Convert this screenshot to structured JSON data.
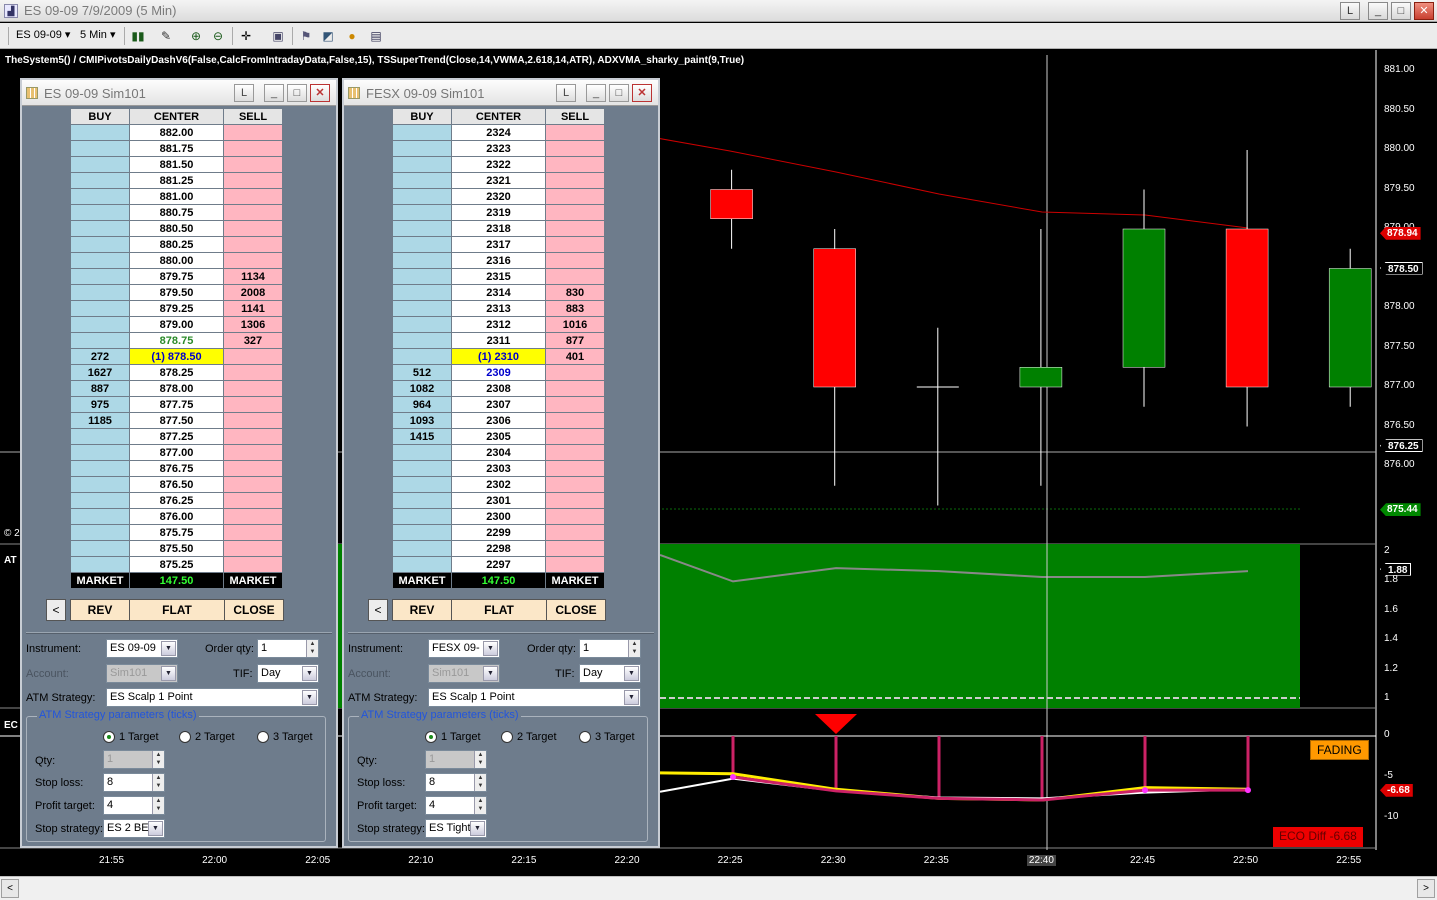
{
  "window": {
    "title": "ES 09-09  7/9/2009 (5 Min)",
    "restore_label": "L",
    "minimize_label": "_",
    "maximize_label": "□",
    "close_label": "✕"
  },
  "toolbar": {
    "instrument": "ES 09-09",
    "interval": "5 Min"
  },
  "chart": {
    "indicator_text": "TheSystem5() / CMIPivotsDailyDashV6(False,CalcFromIntradayData,False,15), TSSuperTrend(Close,14,VWMA,2.618,14,ATR), ADXVMA_sharky_paint(9,True)",
    "left_labels": [
      "© 2",
      "AT",
      "EC"
    ],
    "price_axis": [
      "881.00",
      "880.50",
      "880.00",
      "879.50",
      "879.00",
      "878.50",
      "878.00",
      "877.50",
      "877.00",
      "876.50",
      "876.25",
      "876.00",
      "875.44"
    ],
    "price_tags": [
      {
        "value": "878.94",
        "bg": "#dd0000",
        "fg": "#ffffff"
      },
      {
        "value": "878.50",
        "bg": "#000000",
        "fg": "#ffffff"
      },
      {
        "value": "876.25",
        "bg": "#000000",
        "fg": "#ffffff"
      },
      {
        "value": "875.44",
        "bg": "#008800",
        "fg": "#ffffff"
      }
    ],
    "atr_axis": [
      "2",
      "1.8",
      "1.6",
      "1.4",
      "1.2",
      "1"
    ],
    "atr_tag": "1.88",
    "eco_axis": [
      "0",
      "-5",
      "-10"
    ],
    "eco_tag": "-6.68",
    "fading_label": "FADING",
    "eco_diff_label": "ECO Diff -6.68",
    "time_axis": [
      "21:55",
      "22:00",
      "22:05",
      "22:10",
      "22:15",
      "22:20",
      "22:25",
      "22:30",
      "22:35",
      "22:40",
      "22:45",
      "22:50",
      "22:55"
    ],
    "colors": {
      "up": "#008000",
      "down": "#ff0000",
      "atr_bg": "#008000",
      "eco_pink": "#cc2266",
      "eco_yellow": "#ffee00"
    },
    "candles": [
      {
        "time": "22:25",
        "open": 879.5,
        "high": 879.75,
        "low": 878.75,
        "close": 879.13
      },
      {
        "time": "22:30",
        "open": 878.75,
        "high": 879.0,
        "low": 875.75,
        "close": 877.0
      },
      {
        "time": "22:35",
        "open": 877.0,
        "high": 877.75,
        "low": 875.5,
        "close": 877.0
      },
      {
        "time": "22:40",
        "open": 877.0,
        "high": 879.0,
        "low": 875.75,
        "close": 877.25
      },
      {
        "time": "22:45",
        "open": 877.25,
        "high": 879.5,
        "low": 876.75,
        "close": 879.0
      },
      {
        "time": "22:50",
        "open": 879.0,
        "high": 880.0,
        "low": 876.5,
        "close": 877.0
      },
      {
        "time": "22:55",
        "open": 877.0,
        "high": 878.75,
        "low": 876.75,
        "close": 878.5
      }
    ]
  },
  "dom_windows": [
    {
      "title": "ES 09-09 Sim101",
      "headers": {
        "buy": "BUY",
        "center": "CENTER",
        "sell": "SELL"
      },
      "rows": [
        {
          "buy": "",
          "center": "882.00",
          "sell": ""
        },
        {
          "buy": "",
          "center": "881.75",
          "sell": ""
        },
        {
          "buy": "",
          "center": "881.50",
          "sell": ""
        },
        {
          "buy": "",
          "center": "881.25",
          "sell": ""
        },
        {
          "buy": "",
          "center": "881.00",
          "sell": ""
        },
        {
          "buy": "",
          "center": "880.75",
          "sell": ""
        },
        {
          "buy": "",
          "center": "880.50",
          "sell": ""
        },
        {
          "buy": "",
          "center": "880.25",
          "sell": ""
        },
        {
          "buy": "",
          "center": "880.00",
          "sell": ""
        },
        {
          "buy": "",
          "center": "879.75",
          "sell": "1134"
        },
        {
          "buy": "",
          "center": "879.50",
          "sell": "2008"
        },
        {
          "buy": "",
          "center": "879.25",
          "sell": "1141"
        },
        {
          "buy": "",
          "center": "879.00",
          "sell": "1306"
        },
        {
          "buy": "",
          "center": "878.75",
          "sell": "327",
          "style": "last"
        },
        {
          "buy": "272",
          "center": "(1) 878.50",
          "sell": "",
          "style": "cur"
        },
        {
          "buy": "1627",
          "center": "878.25",
          "sell": ""
        },
        {
          "buy": "887",
          "center": "878.00",
          "sell": ""
        },
        {
          "buy": "975",
          "center": "877.75",
          "sell": ""
        },
        {
          "buy": "1185",
          "center": "877.50",
          "sell": ""
        },
        {
          "buy": "",
          "center": "877.25",
          "sell": ""
        },
        {
          "buy": "",
          "center": "877.00",
          "sell": ""
        },
        {
          "buy": "",
          "center": "876.75",
          "sell": ""
        },
        {
          "buy": "",
          "center": "876.50",
          "sell": ""
        },
        {
          "buy": "",
          "center": "876.25",
          "sell": ""
        },
        {
          "buy": "",
          "center": "876.00",
          "sell": ""
        },
        {
          "buy": "",
          "center": "875.75",
          "sell": ""
        },
        {
          "buy": "",
          "center": "875.50",
          "sell": ""
        },
        {
          "buy": "",
          "center": "875.25",
          "sell": ""
        }
      ],
      "market": {
        "left": "MARKET",
        "center": "147.50",
        "right": "MARKET"
      },
      "buttons": {
        "back": "<",
        "rev": "REV",
        "flat": "FLAT",
        "close": "CLOSE"
      },
      "instrument_label": "Instrument:",
      "instrument": "ES 09-09",
      "order_qty_label": "Order qty:",
      "order_qty": "1",
      "account_label": "Account:",
      "account": "Sim101",
      "tif_label": "TIF:",
      "tif": "Day",
      "atm_label": "ATM Strategy:",
      "atm": "ES Scalp 1 Point",
      "params_label": "ATM Strategy parameters (ticks)",
      "targets": [
        "1 Target",
        "2 Target",
        "3 Target"
      ],
      "selected_target": 0,
      "qty_label": "Qty:",
      "qty": "1",
      "stop_loss_label": "Stop loss:",
      "stop_loss": "8",
      "profit_target_label": "Profit target:",
      "profit_target": "4",
      "stop_strategy_label": "Stop strategy:",
      "stop_strategy": "ES 2 BE"
    },
    {
      "title": "FESX 09-09 Sim101",
      "headers": {
        "buy": "BUY",
        "center": "CENTER",
        "sell": "SELL"
      },
      "rows": [
        {
          "buy": "",
          "center": "2324",
          "sell": ""
        },
        {
          "buy": "",
          "center": "2323",
          "sell": ""
        },
        {
          "buy": "",
          "center": "2322",
          "sell": ""
        },
        {
          "buy": "",
          "center": "2321",
          "sell": ""
        },
        {
          "buy": "",
          "center": "2320",
          "sell": ""
        },
        {
          "buy": "",
          "center": "2319",
          "sell": ""
        },
        {
          "buy": "",
          "center": "2318",
          "sell": ""
        },
        {
          "buy": "",
          "center": "2317",
          "sell": ""
        },
        {
          "buy": "",
          "center": "2316",
          "sell": ""
        },
        {
          "buy": "",
          "center": "2315",
          "sell": ""
        },
        {
          "buy": "",
          "center": "2314",
          "sell": "830"
        },
        {
          "buy": "",
          "center": "2313",
          "sell": "883"
        },
        {
          "buy": "",
          "center": "2312",
          "sell": "1016"
        },
        {
          "buy": "",
          "center": "2311",
          "sell": "877"
        },
        {
          "buy": "",
          "center": "(1) 2310",
          "sell": "401",
          "style": "cur"
        },
        {
          "buy": "512",
          "center": "2309",
          "sell": "",
          "style": "bid"
        },
        {
          "buy": "1082",
          "center": "2308",
          "sell": ""
        },
        {
          "buy": "964",
          "center": "2307",
          "sell": ""
        },
        {
          "buy": "1093",
          "center": "2306",
          "sell": ""
        },
        {
          "buy": "1415",
          "center": "2305",
          "sell": ""
        },
        {
          "buy": "",
          "center": "2304",
          "sell": ""
        },
        {
          "buy": "",
          "center": "2303",
          "sell": ""
        },
        {
          "buy": "",
          "center": "2302",
          "sell": ""
        },
        {
          "buy": "",
          "center": "2301",
          "sell": ""
        },
        {
          "buy": "",
          "center": "2300",
          "sell": ""
        },
        {
          "buy": "",
          "center": "2299",
          "sell": ""
        },
        {
          "buy": "",
          "center": "2298",
          "sell": ""
        },
        {
          "buy": "",
          "center": "2297",
          "sell": ""
        }
      ],
      "market": {
        "left": "MARKET",
        "center": "147.50",
        "right": "MARKET"
      },
      "buttons": {
        "back": "<",
        "rev": "REV",
        "flat": "FLAT",
        "close": "CLOSE"
      },
      "instrument_label": "Instrument:",
      "instrument": "FESX 09-",
      "order_qty_label": "Order qty:",
      "order_qty": "1",
      "account_label": "Account:",
      "account": "Sim101",
      "tif_label": "TIF:",
      "tif": "Day",
      "atm_label": "ATM Strategy:",
      "atm": "ES Scalp 1 Point",
      "params_label": "ATM Strategy parameters (ticks)",
      "targets": [
        "1 Target",
        "2 Target",
        "3 Target"
      ],
      "selected_target": 0,
      "qty_label": "Qty:",
      "qty": "1",
      "stop_loss_label": "Stop loss:",
      "stop_loss": "8",
      "profit_target_label": "Profit target:",
      "profit_target": "4",
      "stop_strategy_label": "Stop strategy:",
      "stop_strategy": "ES Tight"
    }
  ],
  "scrollbar": {
    "left": "<",
    "right": ">"
  }
}
